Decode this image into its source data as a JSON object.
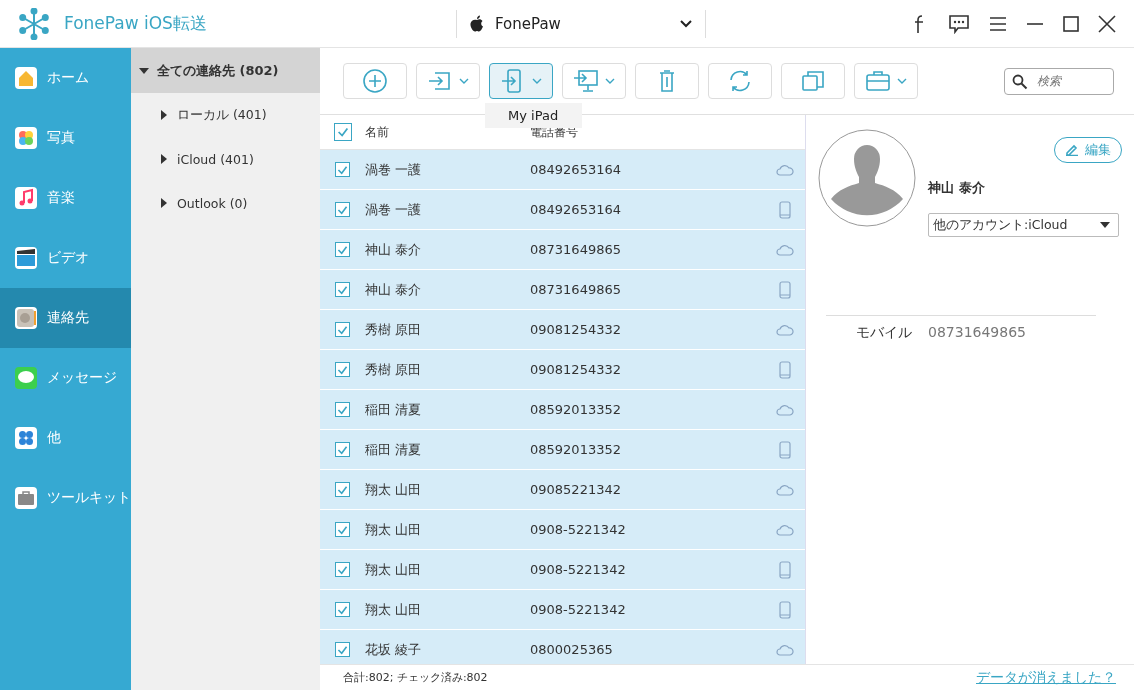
{
  "window": {
    "title": "FonePaw iOS転送"
  },
  "device": {
    "name": "FonePaw"
  },
  "sidebar": {
    "items": [
      {
        "label": "ホーム",
        "kind": "home",
        "selected": false
      },
      {
        "label": "写真",
        "kind": "photos",
        "selected": false
      },
      {
        "label": "音楽",
        "kind": "music",
        "selected": false
      },
      {
        "label": "ビデオ",
        "kind": "video",
        "selected": false
      },
      {
        "label": "連絡先",
        "kind": "contacts",
        "selected": true
      },
      {
        "label": "メッセージ",
        "kind": "messages",
        "selected": false
      },
      {
        "label": "他",
        "kind": "other",
        "selected": false
      },
      {
        "label": "ツールキット",
        "kind": "toolkit",
        "selected": false
      }
    ]
  },
  "groups": [
    {
      "label": "全ての連絡先 (802)",
      "expanded": true,
      "selected": true,
      "children": [
        {
          "label": "ローカル (401)",
          "expanded": false,
          "selected": false
        },
        {
          "label": "iCloud (401)",
          "expanded": false,
          "selected": false
        },
        {
          "label": "Outlook (0)",
          "expanded": false,
          "selected": false
        }
      ]
    }
  ],
  "toolbar": [
    {
      "kind": "add",
      "has_menu": false,
      "selected": false
    },
    {
      "kind": "import",
      "has_menu": true,
      "selected": false
    },
    {
      "kind": "device",
      "has_menu": true,
      "selected": true
    },
    {
      "kind": "computer",
      "has_menu": true,
      "selected": false
    },
    {
      "kind": "delete",
      "has_menu": false,
      "selected": false
    },
    {
      "kind": "sync",
      "has_menu": false,
      "selected": false
    },
    {
      "kind": "duplicate",
      "has_menu": false,
      "selected": false
    },
    {
      "kind": "toolbox",
      "has_menu": true,
      "selected": false
    }
  ],
  "tooltip": "My iPad",
  "search": {
    "placeholder": "検索"
  },
  "table": {
    "all_checked": true,
    "columns": [
      "名前",
      "電話番号"
    ],
    "rows": [
      {
        "name": "渦巻 一護",
        "phone": "08492653164",
        "kind": "cloud",
        "checked": true
      },
      {
        "name": "渦巻 一護",
        "phone": "08492653164",
        "kind": "phone",
        "checked": true
      },
      {
        "name": "神山 泰介",
        "phone": "08731649865",
        "kind": "cloud",
        "checked": true
      },
      {
        "name": "神山 泰介",
        "phone": "08731649865",
        "kind": "phone",
        "checked": true
      },
      {
        "name": "秀樹 原田",
        "phone": "09081254332",
        "kind": "cloud",
        "checked": true
      },
      {
        "name": "秀樹 原田",
        "phone": "09081254332",
        "kind": "phone",
        "checked": true
      },
      {
        "name": "稲田 清夏",
        "phone": "08592013352",
        "kind": "cloud",
        "checked": true
      },
      {
        "name": "稲田 清夏",
        "phone": "08592013352",
        "kind": "phone",
        "checked": true
      },
      {
        "name": "翔太 山田",
        "phone": "09085221342",
        "kind": "cloud",
        "checked": true
      },
      {
        "name": "翔太 山田",
        "phone": "0908-5221342",
        "kind": "cloud",
        "checked": true
      },
      {
        "name": "翔太 山田",
        "phone": "0908-5221342",
        "kind": "phone",
        "checked": true
      },
      {
        "name": "翔太 山田",
        "phone": "0908-5221342",
        "kind": "phone",
        "checked": true
      },
      {
        "name": "花坂 綾子",
        "phone": "0800025365",
        "kind": "cloud",
        "checked": true
      }
    ]
  },
  "detail": {
    "edit": "編集",
    "name": "神山 泰介",
    "account": "他のアカウント:iCloud",
    "fields": [
      {
        "label": "モバイル",
        "value": "08731649865"
      }
    ]
  },
  "status": {
    "summary": "合計:802; チェック済み:802",
    "link": "データが消えました？"
  }
}
